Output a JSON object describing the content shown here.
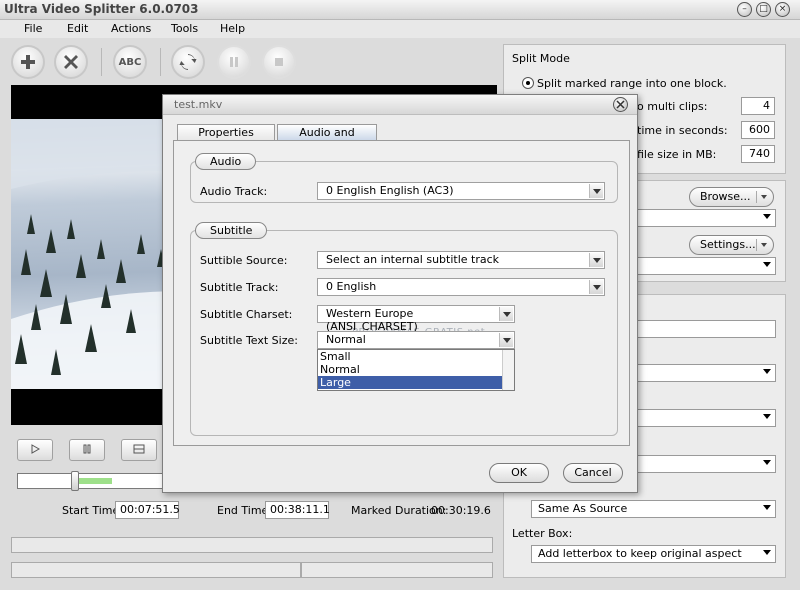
{
  "app": {
    "title": "Ultra Video Splitter 6.0.0703"
  },
  "menu": [
    "File",
    "Edit",
    "Actions",
    "Tools",
    "Help"
  ],
  "toolbar": {
    "add_icon": "plus-icon",
    "remove_icon": "x-icon",
    "abc_label": "ABC",
    "convert_icon": "refresh-icon",
    "pause_icon": "pause-icon",
    "stop_icon": "stop-icon"
  },
  "playback": {
    "play_icon": "play-icon",
    "pause_icon": "pause-icon",
    "frame_icon": "frame-icon",
    "slider_start_fraction": 0.33,
    "slider_end_fraction": 0.54
  },
  "times": {
    "start_label": "Start Time:",
    "start_value": "00:07:51.5",
    "end_label": "End Time:",
    "end_value": "00:38:11.1",
    "duration_label": "Marked Duration:",
    "duration_value": "00:30:19.6"
  },
  "split_mode": {
    "title": "Split Mode",
    "option1": "Split  marked range into one block.",
    "row1_label": "o multi clips:",
    "row1_value": "4",
    "row2_label": "time in seconds:",
    "row2_value": "600",
    "row3_label": "file size in MB:",
    "row3_value": "740"
  },
  "output": {
    "browse_label": "Browse...",
    "settings_label": "Settings...",
    "same_as_source": "Same As Source",
    "letterbox_label": "Letter Box:",
    "letterbox_value": "Add letterbox to keep original aspect"
  },
  "dialog": {
    "title": "test.mkv",
    "tabs": [
      "Properties",
      "Audio and Subtitle"
    ],
    "audio_group": "Audio",
    "audio_track_label": "Audio Track:",
    "audio_track_value": "0   English   English (AC3)",
    "subtitle_group": "Subtitle",
    "subtitle_source_label": "Suttible Source:",
    "subtitle_source_value": "Select an internal subtitle track",
    "subtitle_track_label": "Subtitle Track:",
    "subtitle_track_value": "0   English",
    "subtitle_charset_label": "Subtitle Charset:",
    "subtitle_charset_value": "Western Europe (ANSI_CHARSET)",
    "subtitle_size_label": "Subtitle Text Size:",
    "subtitle_size_value": "Normal",
    "size_options": [
      "Small",
      "Normal",
      "Large"
    ],
    "ok_label": "OK",
    "cancel_label": "Cancel",
    "watermark": "PROGRAMAS-GRATIS.net"
  }
}
